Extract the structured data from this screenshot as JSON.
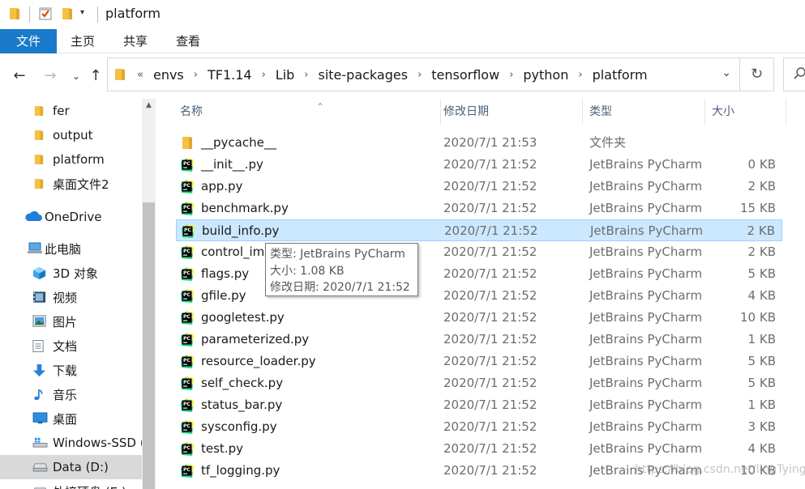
{
  "window": {
    "title": "platform"
  },
  "ribbon": {
    "tabs": [
      "文件",
      "主页",
      "共享",
      "查看"
    ]
  },
  "address": {
    "prefix": "«",
    "crumbs": [
      "envs",
      "TF1.14",
      "Lib",
      "site-packages",
      "tensorflow",
      "python",
      "platform"
    ],
    "separator": "›"
  },
  "sidebar": {
    "items": [
      {
        "label": "fer",
        "icon": "folder-icon"
      },
      {
        "label": "output",
        "icon": "folder-icon"
      },
      {
        "label": "platform",
        "icon": "folder-icon"
      },
      {
        "label": "桌面文件2",
        "icon": "folder-icon"
      },
      {
        "label": "OneDrive",
        "icon": "cloud-icon"
      },
      {
        "label": "此电脑",
        "icon": "computer-icon"
      },
      {
        "label": "3D 对象",
        "icon": "cube-icon"
      },
      {
        "label": "视频",
        "icon": "video-icon"
      },
      {
        "label": "图片",
        "icon": "picture-icon"
      },
      {
        "label": "文档",
        "icon": "document-icon"
      },
      {
        "label": "下载",
        "icon": "download-icon"
      },
      {
        "label": "音乐",
        "icon": "music-icon"
      },
      {
        "label": "桌面",
        "icon": "desktop-icon"
      },
      {
        "label": "Windows-SSD (",
        "icon": "windows-drive-icon"
      },
      {
        "label": "Data (D:)",
        "icon": "drive-icon",
        "selected": true
      },
      {
        "label": "外接硬盘 (E:)",
        "icon": "drive-icon"
      }
    ]
  },
  "columns": {
    "name": "名称",
    "date": "修改日期",
    "type": "类型",
    "size": "大小"
  },
  "files": [
    {
      "name": "__pycache__",
      "date": "2020/7/1 21:53",
      "type": "文件夹",
      "size": "",
      "icon": "folder-icon"
    },
    {
      "name": "__init__.py",
      "date": "2020/7/1 21:52",
      "type": "JetBrains PyCharm",
      "size": "0 KB",
      "icon": "pycharm-file-icon"
    },
    {
      "name": "app.py",
      "date": "2020/7/1 21:52",
      "type": "JetBrains PyCharm",
      "size": "2 KB",
      "icon": "pycharm-file-icon"
    },
    {
      "name": "benchmark.py",
      "date": "2020/7/1 21:52",
      "type": "JetBrains PyCharm",
      "size": "15 KB",
      "icon": "pycharm-file-icon"
    },
    {
      "name": "build_info.py",
      "date": "2020/7/1 21:52",
      "type": "JetBrains PyCharm",
      "size": "2 KB",
      "icon": "pycharm-file-icon",
      "selected": true
    },
    {
      "name": "control_im",
      "date": "2020/7/1 21:52",
      "type": "JetBrains PyCharm",
      "size": "2 KB",
      "icon": "pycharm-file-icon"
    },
    {
      "name": "flags.py",
      "date": "2020/7/1 21:52",
      "type": "JetBrains PyCharm",
      "size": "5 KB",
      "icon": "pycharm-file-icon"
    },
    {
      "name": "gfile.py",
      "date": "2020/7/1 21:52",
      "type": "JetBrains PyCharm",
      "size": "4 KB",
      "icon": "pycharm-file-icon"
    },
    {
      "name": "googletest.py",
      "date": "2020/7/1 21:52",
      "type": "JetBrains PyCharm",
      "size": "10 KB",
      "icon": "pycharm-file-icon"
    },
    {
      "name": "parameterized.py",
      "date": "2020/7/1 21:52",
      "type": "JetBrains PyCharm",
      "size": "1 KB",
      "icon": "pycharm-file-icon"
    },
    {
      "name": "resource_loader.py",
      "date": "2020/7/1 21:52",
      "type": "JetBrains PyCharm",
      "size": "5 KB",
      "icon": "pycharm-file-icon"
    },
    {
      "name": "self_check.py",
      "date": "2020/7/1 21:52",
      "type": "JetBrains PyCharm",
      "size": "5 KB",
      "icon": "pycharm-file-icon"
    },
    {
      "name": "status_bar.py",
      "date": "2020/7/1 21:52",
      "type": "JetBrains PyCharm",
      "size": "1 KB",
      "icon": "pycharm-file-icon"
    },
    {
      "name": "sysconfig.py",
      "date": "2020/7/1 21:52",
      "type": "JetBrains PyCharm",
      "size": "3 KB",
      "icon": "pycharm-file-icon"
    },
    {
      "name": "test.py",
      "date": "2020/7/1 21:52",
      "type": "JetBrains PyCharm",
      "size": "4 KB",
      "icon": "pycharm-file-icon"
    },
    {
      "name": "tf_logging.py",
      "date": "2020/7/1 21:52",
      "type": "JetBrains PyCharm",
      "size": "10 KB",
      "icon": "pycharm-file-icon"
    }
  ],
  "tooltip": {
    "line1": "类型: JetBrains PyCharm",
    "line2": "大小: 1.08 KB",
    "line3": "修改日期: 2020/7/1 21:52"
  },
  "watermark": "https://blog.csdn.net/lingTying",
  "colors": {
    "accent": "#1979ca",
    "selection_bg": "#cce8ff",
    "selection_border": "#99d1ff",
    "folder": "#ffc83d",
    "pycharm_green": "#21d789"
  }
}
